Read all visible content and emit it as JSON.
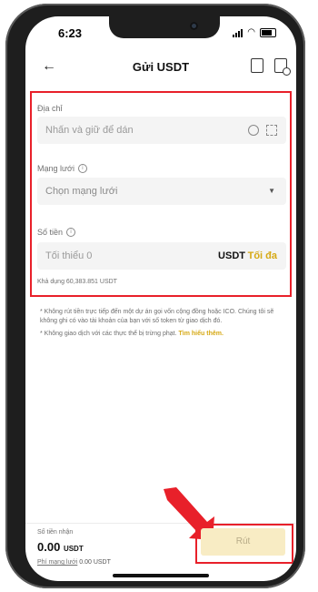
{
  "status": {
    "time": "6:23"
  },
  "header": {
    "title": "Gửi USDT",
    "back_icon": "back-arrow-icon",
    "right_icons": [
      "address-book-icon",
      "history-doc-icon"
    ]
  },
  "form": {
    "address": {
      "label": "Địa chỉ",
      "placeholder": "Nhấn và giữ để dán"
    },
    "network": {
      "label": "Mạng lưới",
      "value": "Chọn mạng lưới"
    },
    "amount": {
      "label": "Số tiền",
      "placeholder": "Tối thiểu 0",
      "unit": "USDT",
      "max_label": "Tối đa"
    },
    "available": "Khả dụng 60,383.851 USDT"
  },
  "notes": {
    "line1": "* Không rút tiền trực tiếp đến một dự án gọi vốn cộng đồng hoặc ICO. Chúng tôi sẽ không ghi có vào tài khoản của bạn với số token từ giao dịch đó.",
    "line2_prefix": "* Không giao dịch với các thực thể bị trừng phạt.",
    "line2_link": "Tìm hiểu thêm."
  },
  "footer": {
    "receive_label": "Số tiền nhận",
    "receive_amount": "0.00",
    "receive_unit": "USDT",
    "fee_label": "Phí mạng lưới",
    "fee_value": "0.00 USDT",
    "withdraw_label": "Rút"
  },
  "colors": {
    "accent": "#d6a915",
    "highlight": "#e8202a",
    "button_bg": "#f8ecc4"
  }
}
